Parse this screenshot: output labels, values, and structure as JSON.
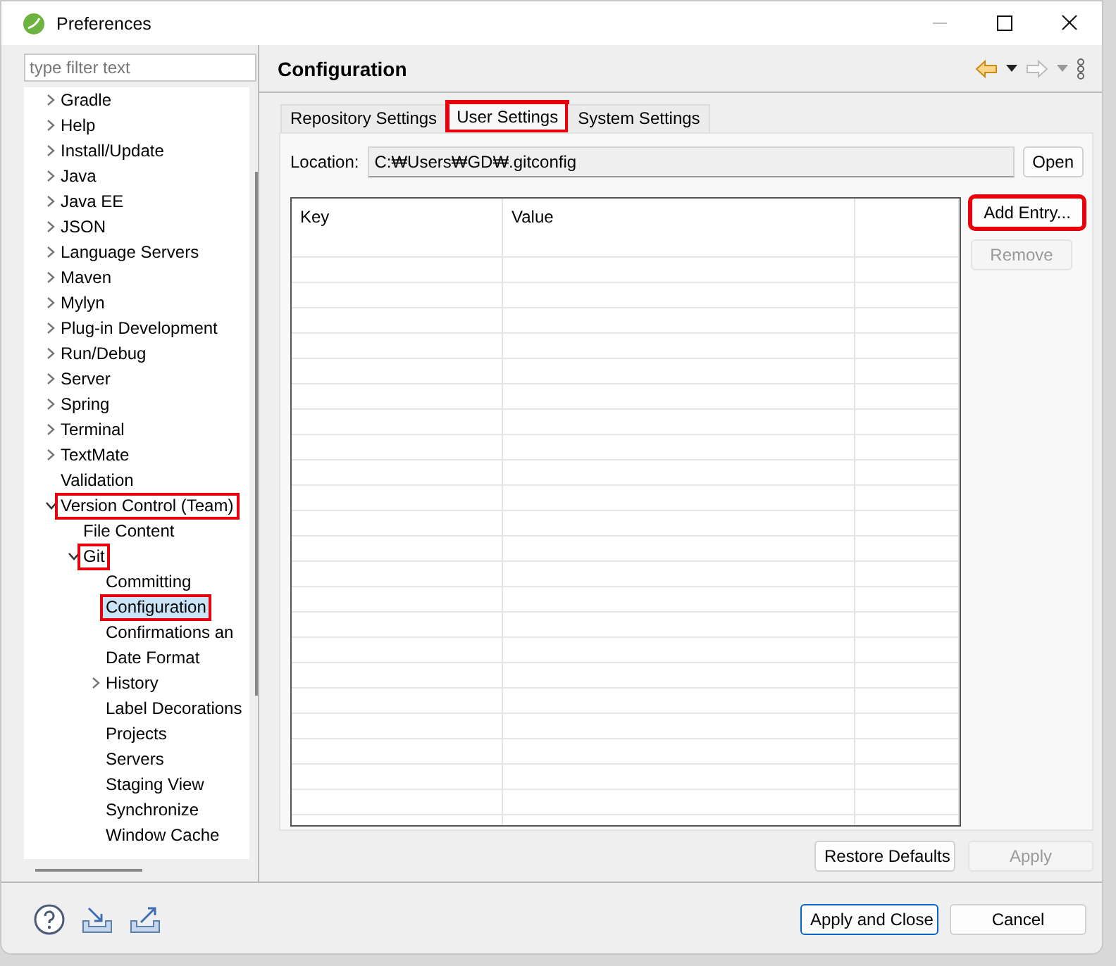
{
  "window": {
    "title": "Preferences"
  },
  "filter": {
    "placeholder": "type filter text"
  },
  "tree": [
    {
      "label": "Gradle",
      "kind": "group",
      "expanded": false,
      "selected": false,
      "highlighted": false
    },
    {
      "label": "Help",
      "kind": "group",
      "expanded": false,
      "selected": false,
      "highlighted": false
    },
    {
      "label": "Install/Update",
      "kind": "group",
      "expanded": false,
      "selected": false,
      "highlighted": false
    },
    {
      "label": "Java",
      "kind": "group",
      "expanded": false,
      "selected": false,
      "highlighted": false
    },
    {
      "label": "Java EE",
      "kind": "group",
      "expanded": false,
      "selected": false,
      "highlighted": false
    },
    {
      "label": "JSON",
      "kind": "group",
      "expanded": false,
      "selected": false,
      "highlighted": false
    },
    {
      "label": "Language Servers",
      "kind": "group",
      "expanded": false,
      "selected": false,
      "highlighted": false
    },
    {
      "label": "Maven",
      "kind": "group",
      "expanded": false,
      "selected": false,
      "highlighted": false
    },
    {
      "label": "Mylyn",
      "kind": "group",
      "expanded": false,
      "selected": false,
      "highlighted": false
    },
    {
      "label": "Plug-in Development",
      "kind": "group",
      "expanded": false,
      "selected": false,
      "highlighted": false
    },
    {
      "label": "Run/Debug",
      "kind": "group",
      "expanded": false,
      "selected": false,
      "highlighted": false
    },
    {
      "label": "Server",
      "kind": "group",
      "expanded": false,
      "selected": false,
      "highlighted": false
    },
    {
      "label": "Spring",
      "kind": "group",
      "expanded": false,
      "selected": false,
      "highlighted": false
    },
    {
      "label": "Terminal",
      "kind": "group",
      "expanded": false,
      "selected": false,
      "highlighted": false
    },
    {
      "label": "TextMate",
      "kind": "group",
      "expanded": false,
      "selected": false,
      "highlighted": false
    },
    {
      "label": "Validation",
      "kind": "leaf",
      "selected": false,
      "highlighted": false
    },
    {
      "label": "Version Control (Team)",
      "kind": "group",
      "expanded": true,
      "selected": false,
      "highlighted": true,
      "children": [
        {
          "label": "File Content",
          "kind": "leaf",
          "selected": false,
          "highlighted": false
        },
        {
          "label": "Git",
          "kind": "group",
          "expanded": true,
          "selected": false,
          "highlighted": true,
          "children": [
            {
              "label": "Committing",
              "kind": "leaf",
              "selected": false,
              "highlighted": false
            },
            {
              "label": "Configuration",
              "kind": "leaf",
              "selected": true,
              "highlighted": true
            },
            {
              "label": "Confirmations an",
              "kind": "leaf",
              "selected": false,
              "highlighted": false
            },
            {
              "label": "Date Format",
              "kind": "leaf",
              "selected": false,
              "highlighted": false
            },
            {
              "label": "History",
              "kind": "group",
              "expanded": false,
              "selected": false,
              "highlighted": false
            },
            {
              "label": "Label Decorations",
              "kind": "leaf",
              "selected": false,
              "highlighted": false
            },
            {
              "label": "Projects",
              "kind": "leaf",
              "selected": false,
              "highlighted": false
            },
            {
              "label": "Servers",
              "kind": "leaf",
              "selected": false,
              "highlighted": false
            },
            {
              "label": "Staging View",
              "kind": "leaf",
              "selected": false,
              "highlighted": false
            },
            {
              "label": "Synchronize",
              "kind": "leaf",
              "selected": false,
              "highlighted": false
            },
            {
              "label": "Window Cache",
              "kind": "leaf",
              "selected": false,
              "highlighted": false
            }
          ]
        }
      ]
    }
  ],
  "page": {
    "title": "Configuration",
    "tabs": [
      {
        "label": "Repository Settings",
        "selected": false,
        "highlighted": false
      },
      {
        "label": "User Settings",
        "selected": true,
        "highlighted": true
      },
      {
        "label": "System Settings",
        "selected": false,
        "highlighted": false
      }
    ],
    "location": {
      "label": "Location:",
      "value": "C:₩Users₩GD₩.gitconfig",
      "button": "Open"
    },
    "table": {
      "columns": [
        "Key",
        "Value"
      ]
    },
    "side_buttons": [
      {
        "label": "Add Entry...",
        "disabled": false,
        "highlighted": true
      },
      {
        "label": "Remove",
        "disabled": true,
        "highlighted": false
      }
    ],
    "buttons": [
      {
        "label": "Restore Defaults",
        "disabled": false
      },
      {
        "label": "Apply",
        "disabled": true
      }
    ]
  },
  "footer": {
    "buttons": [
      {
        "label": "Apply and Close",
        "default": true
      },
      {
        "label": "Cancel",
        "default": false
      }
    ]
  }
}
